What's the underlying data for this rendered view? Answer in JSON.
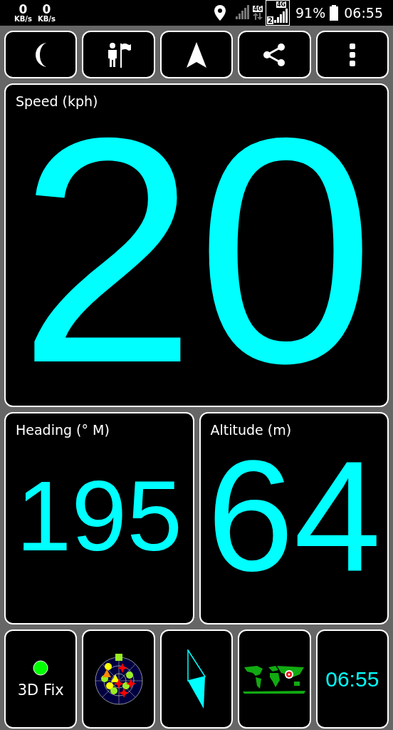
{
  "status_bar": {
    "net_speeds": [
      {
        "value": "0",
        "unit": "KB/s"
      },
      {
        "value": "0",
        "unit": "KB/s"
      }
    ],
    "network_badges": [
      "4G",
      "4G"
    ],
    "sim_number": "2",
    "battery": "91%",
    "time": "06:55"
  },
  "toolbar": [
    {
      "kind": "moon"
    },
    {
      "kind": "waypoint"
    },
    {
      "kind": "navigate"
    },
    {
      "kind": "share"
    },
    {
      "kind": "more"
    }
  ],
  "speed": {
    "label": "Speed (kph)",
    "value": "20"
  },
  "heading": {
    "label": "Heading (° M)",
    "value": "195"
  },
  "altitude": {
    "label": "Altitude (m)",
    "value": "64"
  },
  "fix": {
    "label": "3D Fix",
    "color": "#00ff00"
  },
  "clock": {
    "time": "06:55"
  }
}
